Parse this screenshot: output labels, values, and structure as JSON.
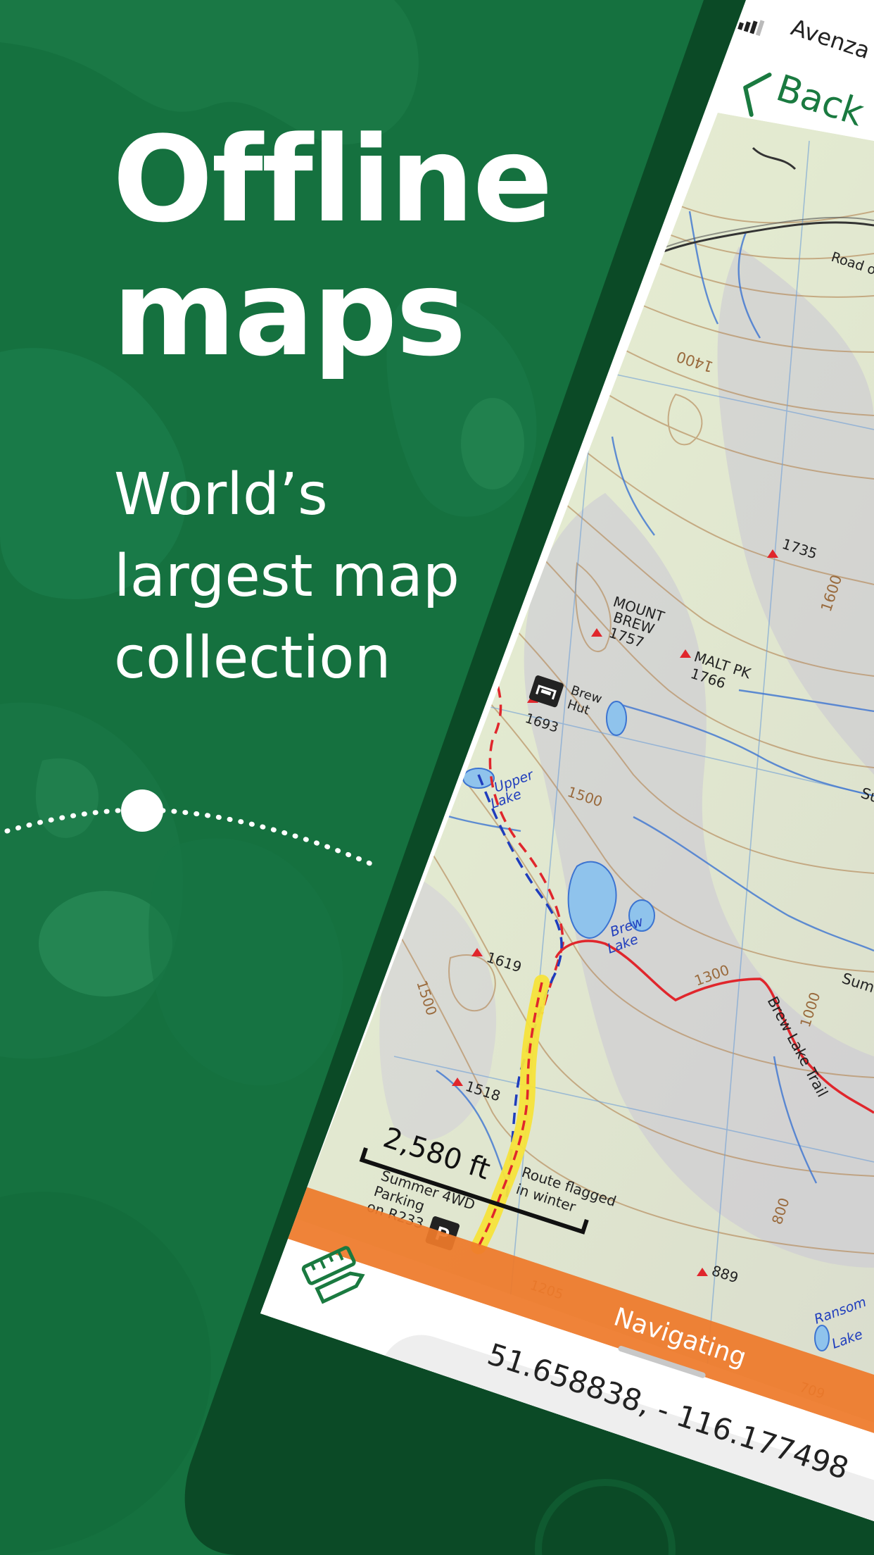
{
  "headline": {
    "line1": "Offline",
    "line2": "maps"
  },
  "subheadline": {
    "line1": "World’s",
    "line2": "largest map",
    "line3": "collection"
  },
  "status_bar": {
    "carrier": "Avenza"
  },
  "nav": {
    "back_label": "Back"
  },
  "map": {
    "labels": {
      "road": "Road out",
      "contour_1400": "1400",
      "contour_1600": "1600",
      "contour_1500_a": "1500",
      "contour_1500_b": "1500",
      "contour_1300": "1300",
      "contour_1000": "1000",
      "contour_800": "800",
      "contour_1205": "1205",
      "contour_709": "709",
      "peak_1735": "1735",
      "mount_brew": "MOUNT",
      "mount_brew_2": "BREW",
      "mount_brew_elev": "1757",
      "malt_pk": "MALT PK",
      "malt_pk_elev": "1766",
      "brew_hut": "Brew",
      "brew_hut_2": "Hut",
      "hut_elev": "1693",
      "upper_lake": "Upper",
      "upper_lake_2": "Lake",
      "brew_lake": "Brew",
      "brew_lake_2": "Lake",
      "peak_1619": "1619",
      "peak_1518": "1518",
      "peak_889": "889",
      "brew_lake_trail": "Brew Lake Trail",
      "route_note": "Route flagged",
      "route_note_2": "in winter",
      "parking": "Summer 4WD",
      "parking_2": "Parking",
      "parking_3": "on R233",
      "parking_icon": "P",
      "ransom_lake": "Ransom",
      "ransom_lake_2": "Lake",
      "sum_a": "Su",
      "sum_b": "Sum"
    },
    "scale_bar": "2,580 ft"
  },
  "navigation_status": "Navigating",
  "coordinates": "51.658838, - 116.177498",
  "icons": {
    "measure_tool": "ruler-pencil-icon",
    "back": "chevron-left-icon",
    "signal": "signal-bars-icon",
    "hut": "hut-icon",
    "parking": "parking-icon"
  },
  "colors": {
    "brand_green": "#15713f",
    "dark_green": "#0e5a30",
    "frame": "#0b4a26",
    "accent_orange": "#ee7a2a",
    "ui_green": "#1a7a40"
  }
}
